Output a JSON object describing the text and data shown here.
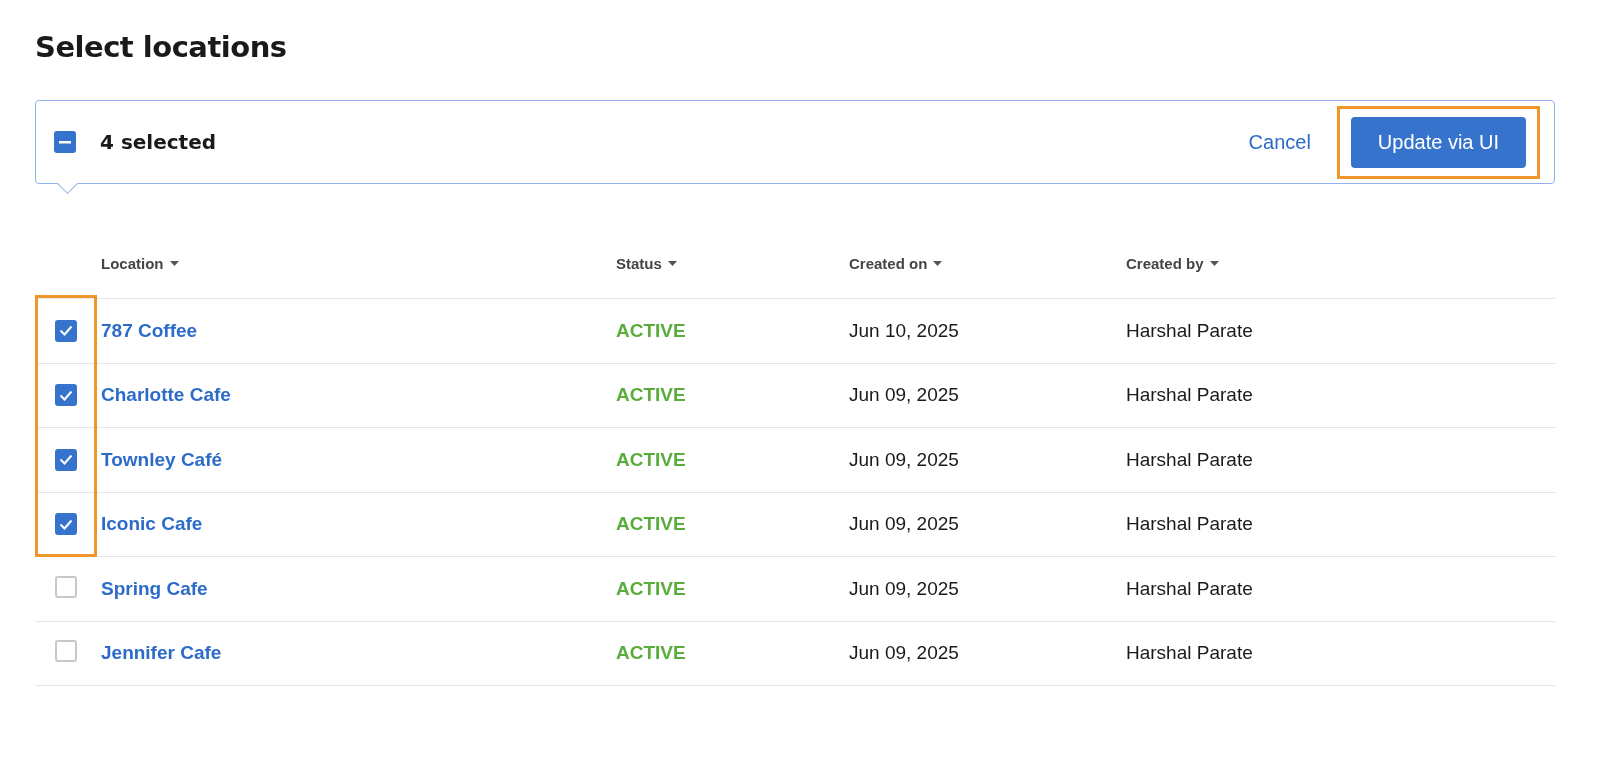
{
  "title": "Select locations",
  "bulk_bar": {
    "partial": true,
    "count_label": "4 selected",
    "cancel": "Cancel",
    "action": {
      "label": "Update via UI",
      "highlighted": true
    }
  },
  "table": {
    "columns": [
      "Location",
      "Status",
      "Created on",
      "Created by"
    ],
    "rows": [
      {
        "checked": true,
        "highlighted": true,
        "location": "787 Coffee",
        "status": "ACTIVE",
        "created_on": "Jun 10, 2025",
        "created_by": "Harshal Parate"
      },
      {
        "checked": true,
        "highlighted": true,
        "location": "Charlotte Cafe",
        "status": "ACTIVE",
        "created_on": "Jun 09, 2025",
        "created_by": "Harshal Parate"
      },
      {
        "checked": true,
        "highlighted": true,
        "location": "Townley Café",
        "status": "ACTIVE",
        "created_on": "Jun 09, 2025",
        "created_by": "Harshal Parate"
      },
      {
        "checked": true,
        "highlighted": true,
        "location": "Iconic Cafe",
        "status": "ACTIVE",
        "created_on": "Jun 09, 2025",
        "created_by": "Harshal Parate"
      },
      {
        "checked": false,
        "highlighted": false,
        "location": "Spring Cafe",
        "status": "ACTIVE",
        "created_on": "Jun 09, 2025",
        "created_by": "Harshal Parate"
      },
      {
        "checked": false,
        "highlighted": false,
        "location": "Jennifer Cafe",
        "status": "ACTIVE",
        "created_on": "Jun 09, 2025",
        "created_by": "Harshal Parate"
      }
    ]
  }
}
